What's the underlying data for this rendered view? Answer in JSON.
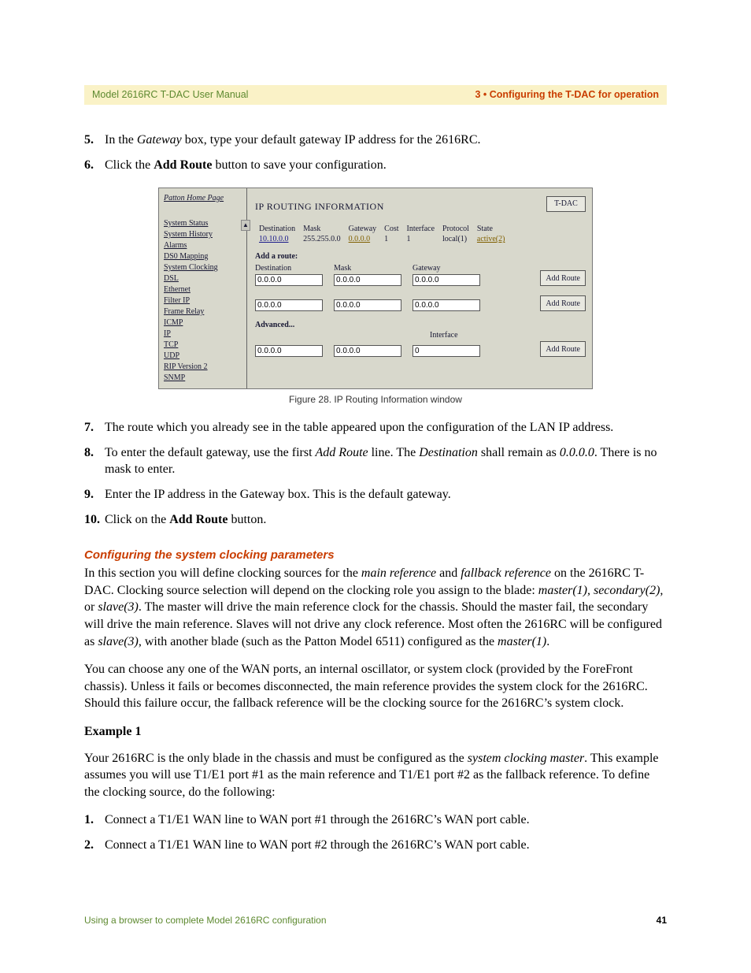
{
  "header": {
    "left": "Model 2616RC T-DAC User Manual",
    "right": "3 • Configuring the T-DAC for operation"
  },
  "stepsA": {
    "s5_p1": "In the ",
    "s5_it": "Gateway",
    "s5_p2": " box, type your default gateway IP address for the 2616RC.",
    "s6_p1": "Click the ",
    "s6_b": "Add Route",
    "s6_p2": " button to save your configuration."
  },
  "fig": {
    "homepage": "Patton Home Page",
    "nav": {
      "system_status": "System Status",
      "system_history": "System History",
      "alarms": "Alarms",
      "ds0_mapping": "DS0 Mapping",
      "system_clocking": "System Clocking",
      "dsl": "DSL",
      "ethernet": "Ethernet",
      "filter_ip": "Filter IP",
      "frame_relay": "Frame Relay",
      "icmp": "ICMP",
      "ip": "IP",
      "tcp": "TCP",
      "udp": "UDP",
      "rip_v2": "RIP Version 2",
      "snmp": "SNMP"
    },
    "scroll_glyph": "▲",
    "title": "IP ROUTING INFORMATION",
    "tdac": "T-DAC",
    "th": {
      "dest": "Destination",
      "mask": "Mask",
      "gw": "Gateway",
      "cost": "Cost",
      "iface": "Interface",
      "proto": "Protocol",
      "state": "State"
    },
    "row": {
      "dest": "10.10.0.0",
      "mask": "255.255.0.0",
      "gw": "0.0.0.0",
      "cost": "1",
      "iface": "1",
      "proto": "local(1)",
      "state": "active(2)"
    },
    "add_a_route": "Add a route:",
    "lbl": {
      "dest": "Destination",
      "mask": "Mask",
      "gw": "Gateway",
      "iface": "Interface"
    },
    "defaults": {
      "ip": "0.0.0.0",
      "iface": "0"
    },
    "btn": "Add Route",
    "advanced": "Advanced...",
    "caption": "Figure 28. IP Routing Information window"
  },
  "stepsB": {
    "s7": "The route which you already see in the table appeared upon the configuration of the LAN IP address.",
    "s8_p1": "To enter the default gateway, use the first ",
    "s8_i1": "Add Route",
    "s8_p2": " line. The ",
    "s8_i2": "Destination",
    "s8_p3": " shall remain as ",
    "s8_i3": "0.0.0.0",
    "s8_p4": ". There is no mask to enter.",
    "s9": "Enter the IP address in the Gateway box. This is the default gateway.",
    "s10_p1": "Click on the ",
    "s10_b": "Add Route",
    "s10_p2": " button."
  },
  "section": {
    "title": "Configuring the system clocking parameters",
    "para1": {
      "p1": "In this section you will define clocking sources for the ",
      "i1": "main reference",
      "p2": " and ",
      "i2": "fallback reference",
      "p3": " on the 2616RC T-DAC. Clocking source selection will depend on the clocking role you assign to the blade: ",
      "i3": "master(1), secondary(2),",
      "p4": " or ",
      "i4": "slave(3)",
      "p5": ". The master will drive the main reference clock for the chassis. Should the master fail, the secondary will drive the main reference. Slaves will not drive any clock reference. Most often the 2616RC will be configured as ",
      "i5": "slave(3)",
      "p6": ", with another blade (such as the Patton Model 6511) configured as the ",
      "i6": "master(1)",
      "p7": "."
    },
    "para2": "You can choose any one of the WAN ports, an internal oscillator, or system clock (provided by the ForeFront chassis). Unless it fails or becomes disconnected, the main reference provides the system clock for the 2616RC. Should this failure occur, the fallback reference will be the clocking source for the 2616RC’s system clock.",
    "example_label": "Example 1",
    "para3": {
      "p1": "Your 2616RC is the only blade in the chassis and must be configured as the ",
      "i1": "system clocking master",
      "p2": ". This example assumes you will use T1/E1 port #1 as the main reference and T1/E1 port #2 as the fallback reference. To define the clocking source, do the following:"
    }
  },
  "stepsC": {
    "s1": "Connect a T1/E1 WAN line to WAN port #1 through the 2616RC’s WAN port cable.",
    "s2": "Connect a T1/E1 WAN line to WAN port #2 through the 2616RC’s WAN port cable."
  },
  "footer": {
    "left": "Using a browser to complete Model 2616RC configuration",
    "page": "41"
  }
}
